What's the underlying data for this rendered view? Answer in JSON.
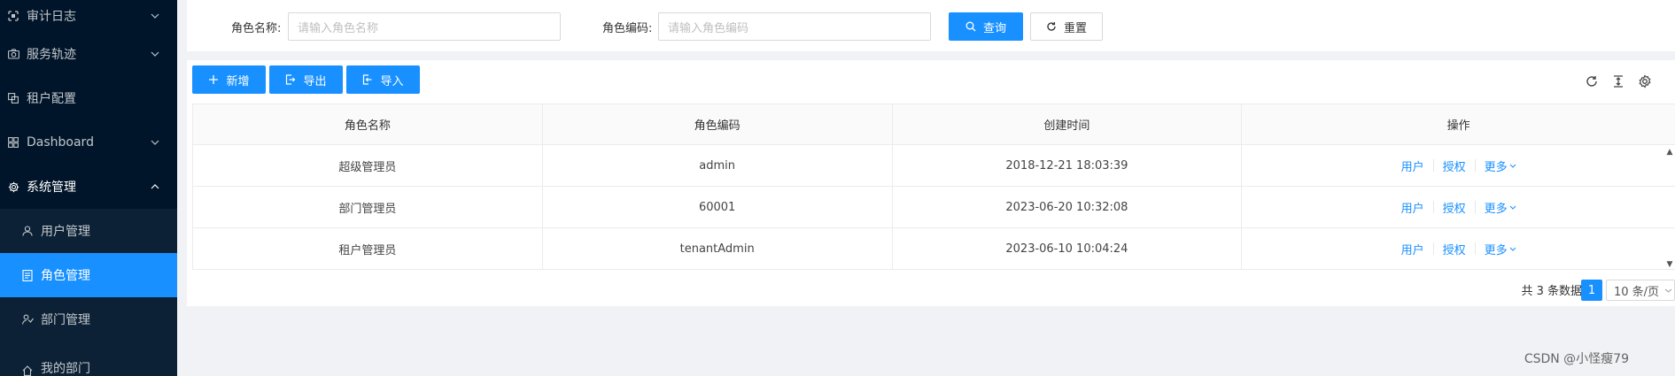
{
  "sidebar": {
    "items": [
      {
        "label": "审计日志",
        "icon": "audit-icon",
        "arrow": "down"
      },
      {
        "label": "服务轨迹",
        "icon": "camera-icon",
        "arrow": "down"
      },
      {
        "label": "租户配置",
        "icon": "tenant-config-icon",
        "arrow": ""
      },
      {
        "label": "Dashboard",
        "icon": "dashboard-icon",
        "arrow": "down"
      },
      {
        "label": "系统管理",
        "icon": "gear-icon",
        "arrow": "up"
      }
    ],
    "subitems": [
      {
        "label": "用户管理",
        "icon": "user-icon"
      },
      {
        "label": "角色管理",
        "icon": "role-icon"
      },
      {
        "label": "部门管理",
        "icon": "department-icon"
      },
      {
        "label": "我的部门",
        "icon": "home-icon"
      }
    ]
  },
  "search": {
    "role_name_label": "角色名称:",
    "role_name_placeholder": "请输入角色名称",
    "role_code_label": "角色编码:",
    "role_code_placeholder": "请输入角色编码",
    "query_label": "查询",
    "reset_label": "重置"
  },
  "toolbar": {
    "add_label": "新增",
    "export_label": "导出",
    "import_label": "导入"
  },
  "table": {
    "columns": [
      "角色名称",
      "角色编码",
      "创建时间",
      "操作"
    ],
    "rows": [
      {
        "name": "超级管理员",
        "code": "admin",
        "created": "2018-12-21 18:03:39"
      },
      {
        "name": "部门管理员",
        "code": "60001",
        "created": "2023-06-20 10:32:08"
      },
      {
        "name": "租户管理员",
        "code": "tenantAdmin",
        "created": "2023-06-10 10:04:24"
      }
    ],
    "actions": {
      "user": "用户",
      "auth": "授权",
      "more": "更多"
    }
  },
  "pagination": {
    "total_text": "共 3 条数据",
    "current_page": "1",
    "page_size": "10 条/页"
  },
  "watermark": "CSDN @小怪瘦79",
  "colors": {
    "primary": "#1890ff",
    "sidebar_bg": "#001529",
    "submenu_bg": "#0c2135"
  }
}
